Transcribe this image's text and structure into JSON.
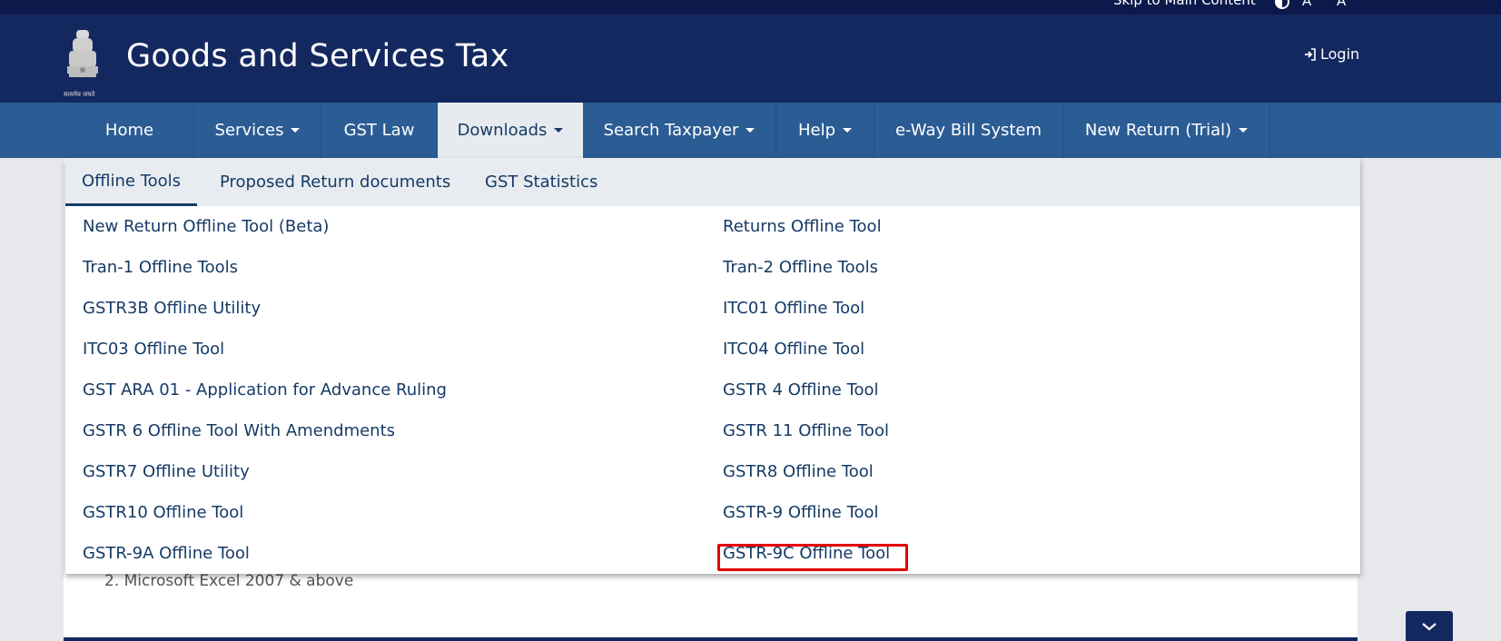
{
  "topbar": {
    "skip_link": "Skip to Main Content",
    "font_increase": "A",
    "font_decrease": "A"
  },
  "header": {
    "title": "Goods and Services Tax",
    "login_label": "Login",
    "emblem_caption": "सत्यमेव जयते"
  },
  "nav": {
    "items": [
      {
        "label": "Home"
      },
      {
        "label": "Services"
      },
      {
        "label": "GST Law"
      },
      {
        "label": "Downloads"
      },
      {
        "label": "Search Taxpayer"
      },
      {
        "label": "Help"
      },
      {
        "label": "e-Way Bill System"
      },
      {
        "label": "New Return (Trial)"
      }
    ]
  },
  "dropdown": {
    "tabs": [
      {
        "label": "Offline Tools"
      },
      {
        "label": "Proposed Return documents"
      },
      {
        "label": "GST Statistics"
      }
    ],
    "col1": [
      "New Return Offline Tool (Beta)",
      "Tran-1 Offline Tools",
      "GSTR3B Offline Utility",
      "ITC03 Offline Tool",
      "GST ARA 01 - Application for Advance Ruling",
      "GSTR 6 Offline Tool With Amendments",
      "GSTR7 Offline Utility",
      "GSTR10 Offline Tool",
      "GSTR-9A Offline Tool"
    ],
    "col2": [
      "Returns Offline Tool",
      "Tran-2 Offline Tools",
      "ITC01 Offline Tool",
      "ITC04 Offline Tool",
      "GSTR 4 Offline Tool",
      "GSTR 11 Offline Tool",
      "GSTR8 Offline Tool",
      "GSTR-9 Offline Tool",
      "GSTR-9C Offline Tool"
    ]
  },
  "content": {
    "list_item": "2. Microsoft Excel 2007 & above"
  },
  "colors": {
    "header_bg": "#142860",
    "nav_bg": "#2b5c94",
    "link_text": "#153a66",
    "highlight_border": "#e60000"
  }
}
